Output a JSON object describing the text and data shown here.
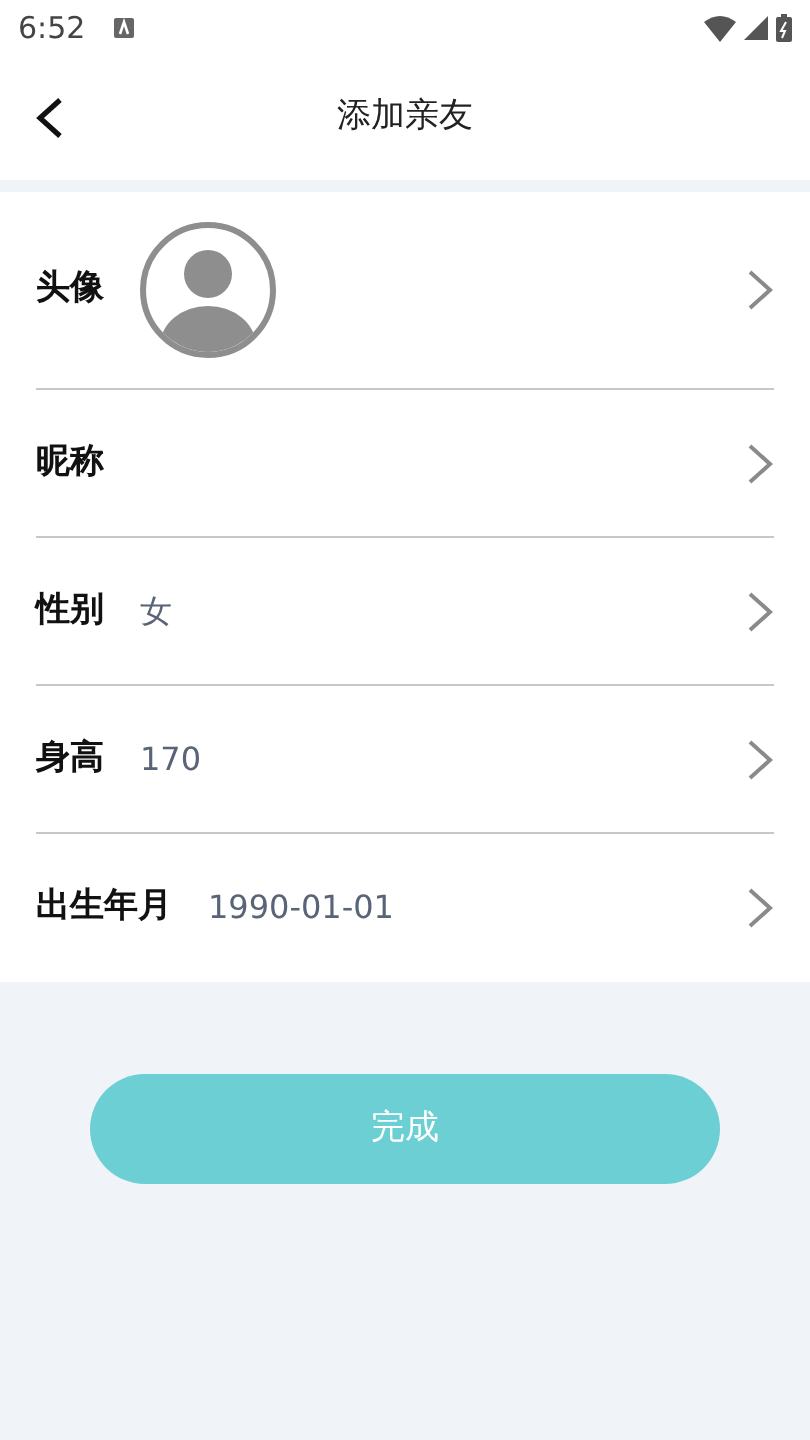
{
  "status_bar": {
    "time": "6:52"
  },
  "header": {
    "title": "添加亲友"
  },
  "rows": [
    {
      "kind": "avatar",
      "label": "头像"
    },
    {
      "kind": "text",
      "label": "昵称"
    },
    {
      "kind": "text",
      "label": "性别",
      "value": "女"
    },
    {
      "kind": "text",
      "label": "身高",
      "value": "170"
    },
    {
      "kind": "text",
      "label": "出生年月",
      "value": "1990-01-01"
    }
  ],
  "submit": {
    "label": "完成"
  }
}
